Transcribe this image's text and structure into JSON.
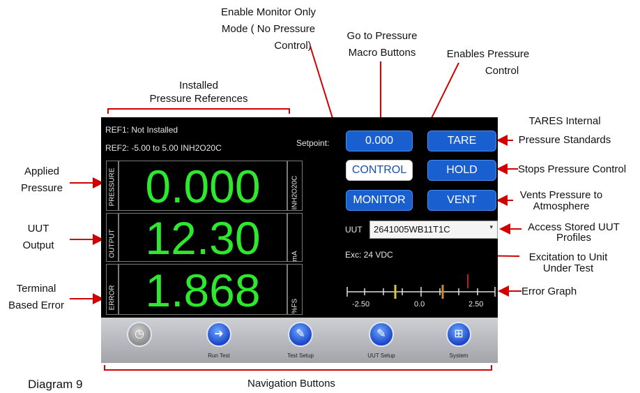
{
  "callouts": {
    "monitor_only": [
      "Enable Monitor Only",
      "Mode ( No Pressure",
      "Control)"
    ],
    "macro": [
      "Go to Pressure",
      "Macro Buttons"
    ],
    "enable_control": [
      "Enables Pressure",
      "Control"
    ],
    "installed_refs": [
      "Installed",
      "Pressure References"
    ],
    "tares": [
      "TARES Internal",
      "Pressure Standards"
    ],
    "stops": "Stops Pressure Control",
    "vents": [
      "Vents Pressure to",
      "Atmosphere"
    ],
    "access_uut": [
      "Access Stored  UUT",
      "Profiles"
    ],
    "excitation": [
      "Excitation to Unit",
      "Under Test"
    ],
    "error_graph": "Error Graph",
    "applied_pressure": [
      "Applied",
      "Pressure"
    ],
    "uut_output": [
      "UUT",
      "Output"
    ],
    "terminal_error": [
      "Terminal",
      "Based Error"
    ],
    "navigation": "Navigation Buttons",
    "diagram_title": "Diagram 9"
  },
  "screen": {
    "ref1": "REF1: Not Installed",
    "ref2": "REF2: -5.00 to 5.00 INH2O20C",
    "setpoint_label": "Setpoint:",
    "setpoint_value": "0.000",
    "tare": "TARE",
    "control": "CONTROL",
    "hold": "HOLD",
    "monitor": "MONITOR",
    "vent": "VENT",
    "uut_label": "UUT",
    "uut_value": "2641005WB11T1C",
    "exc": "Exc:  24 VDC",
    "readouts": [
      {
        "label": "PRESSURE",
        "value": "0.000",
        "unit": "INH2O20C"
      },
      {
        "label": "OUTPUT",
        "value": "12.30",
        "unit": "mA"
      },
      {
        "label": "ERROR",
        "value": "1.868",
        "unit": "%FS"
      }
    ],
    "graph_ticks": [
      "-2.50",
      "0.0",
      "2.50"
    ],
    "nav": [
      "",
      "Run Test",
      "Test Setup",
      "UUT Setup",
      "System"
    ]
  }
}
